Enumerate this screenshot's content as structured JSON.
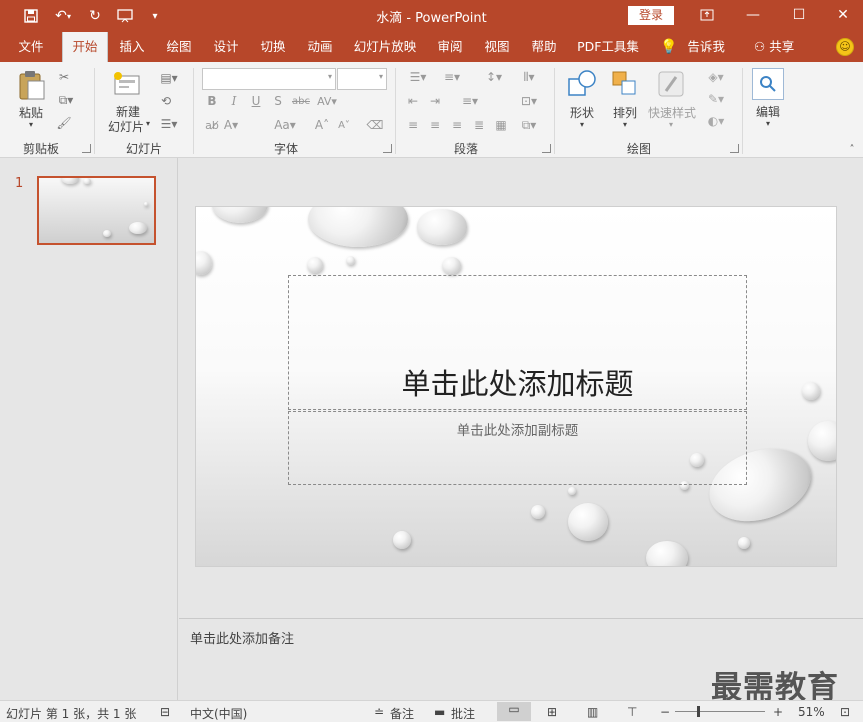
{
  "window": {
    "title": "水滴 - PowerPoint",
    "sign_in": "登录",
    "accent_color": "#b7472a"
  },
  "quick_access": {
    "icons": [
      "save-icon",
      "undo-icon",
      "redo-icon",
      "start-presentation-icon",
      "customize-icon"
    ]
  },
  "tabs": [
    {
      "label": "文件",
      "active": false
    },
    {
      "label": "开始",
      "active": true
    },
    {
      "label": "插入",
      "active": false
    },
    {
      "label": "绘图",
      "active": false
    },
    {
      "label": "设计",
      "active": false
    },
    {
      "label": "切换",
      "active": false
    },
    {
      "label": "动画",
      "active": false
    },
    {
      "label": "幻灯片放映",
      "active": false
    },
    {
      "label": "审阅",
      "active": false
    },
    {
      "label": "视图",
      "active": false
    },
    {
      "label": "帮助",
      "active": false
    },
    {
      "label": "PDF工具集",
      "active": false
    }
  ],
  "tell_me": "告诉我",
  "share": "共享",
  "ribbon": {
    "clipboard": {
      "paste": "粘贴",
      "label": "剪贴板"
    },
    "slides": {
      "new_slide": "新建\n幻灯片",
      "new_slide_line1": "新建",
      "new_slide_line2": "幻灯片",
      "label": "幻灯片"
    },
    "font": {
      "label": "字体",
      "font_name_value": "",
      "font_size_value": ""
    },
    "paragraph": {
      "label": "段落"
    },
    "drawing": {
      "shapes": "形状",
      "arrange": "排列",
      "quick_styles": "快速样式",
      "label": "绘图"
    },
    "editing": {
      "edit": "编辑"
    }
  },
  "thumbnails": [
    {
      "number": "1"
    }
  ],
  "slide": {
    "title_placeholder": "单击此处添加标题",
    "subtitle_placeholder": "单击此处添加副标题"
  },
  "notes_placeholder": "单击此处添加备注",
  "watermark": "最需教育",
  "status": {
    "slide_info": "幻灯片 第 1 张，共 1 张",
    "language": "中文(中国)",
    "notes": "备注",
    "comments": "批注",
    "zoom": "51%"
  }
}
